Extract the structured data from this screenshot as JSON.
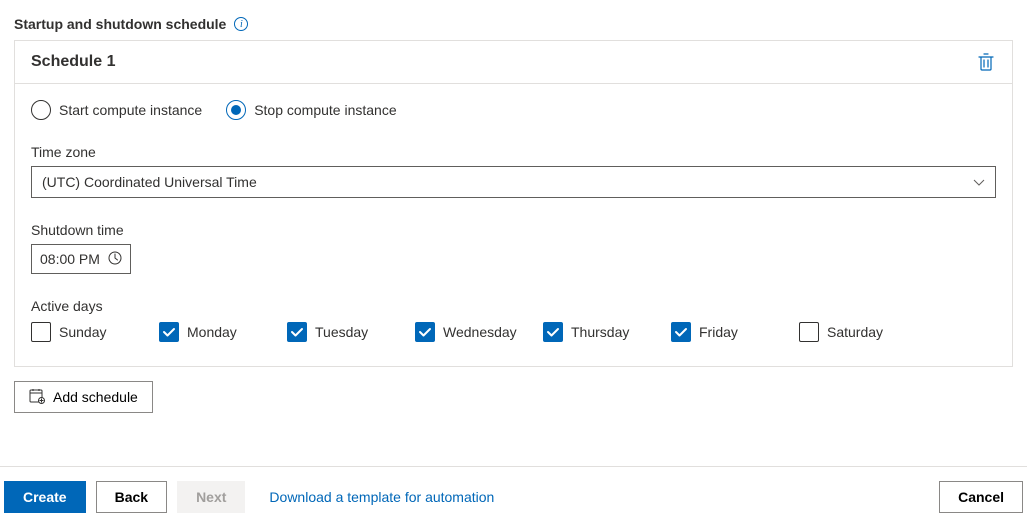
{
  "header": {
    "title": "Startup and shutdown schedule"
  },
  "schedule": {
    "title": "Schedule 1",
    "radios": {
      "start_label": "Start compute instance",
      "stop_label": "Stop compute instance",
      "selected": "stop"
    },
    "timezone": {
      "label": "Time zone",
      "value": "(UTC) Coordinated Universal Time"
    },
    "shutdown_time": {
      "label": "Shutdown time",
      "value": "08:00 PM"
    },
    "active_days": {
      "label": "Active days",
      "days": [
        {
          "label": "Sunday",
          "checked": false
        },
        {
          "label": "Monday",
          "checked": true
        },
        {
          "label": "Tuesday",
          "checked": true
        },
        {
          "label": "Wednesday",
          "checked": true
        },
        {
          "label": "Thursday",
          "checked": true
        },
        {
          "label": "Friday",
          "checked": true
        },
        {
          "label": "Saturday",
          "checked": false
        }
      ]
    }
  },
  "add_schedule_label": "Add schedule",
  "bottom": {
    "create": "Create",
    "back": "Back",
    "next": "Next",
    "download": "Download a template for automation",
    "cancel": "Cancel"
  }
}
